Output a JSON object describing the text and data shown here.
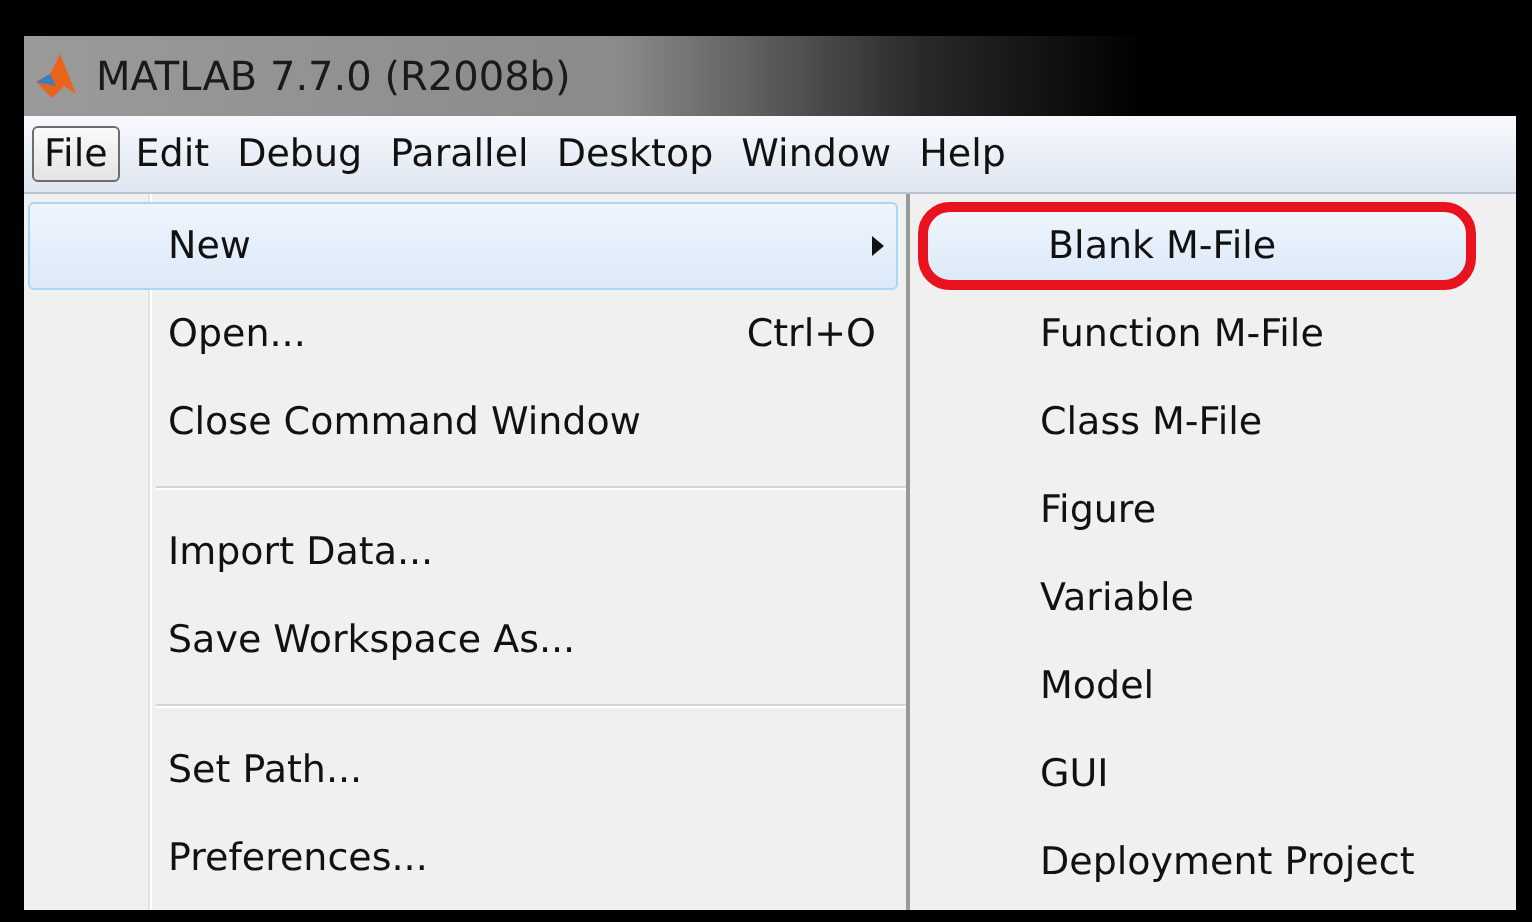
{
  "window": {
    "title": "MATLAB  7.7.0 (R2008b)"
  },
  "menu_bar": [
    {
      "label": "File",
      "selected": true
    },
    {
      "label": "Edit",
      "selected": false
    },
    {
      "label": "Debug",
      "selected": false
    },
    {
      "label": "Parallel",
      "selected": false
    },
    {
      "label": "Desktop",
      "selected": false
    },
    {
      "label": "Window",
      "selected": false
    },
    {
      "label": "Help",
      "selected": false
    }
  ],
  "file_menu": [
    {
      "kind": "item",
      "label": "New",
      "has_submenu": true,
      "highlighted": true
    },
    {
      "kind": "item",
      "label": "Open...",
      "shortcut": "Ctrl+O",
      "has_submenu": false,
      "highlighted": false
    },
    {
      "kind": "item",
      "label": "Close Command Window",
      "has_submenu": false,
      "highlighted": false
    },
    {
      "kind": "separator"
    },
    {
      "kind": "item",
      "label": "Import Data...",
      "has_submenu": false,
      "highlighted": false
    },
    {
      "kind": "item",
      "label": "Save Workspace As...",
      "has_submenu": false,
      "highlighted": false
    },
    {
      "kind": "separator"
    },
    {
      "kind": "item",
      "label": "Set Path...",
      "has_submenu": false,
      "highlighted": false
    },
    {
      "kind": "item",
      "label": "Preferences...",
      "has_submenu": false,
      "highlighted": false
    }
  ],
  "new_submenu": [
    {
      "label": "Blank M-File",
      "highlighted": true,
      "circled": true
    },
    {
      "label": "Function M-File",
      "highlighted": false,
      "circled": false
    },
    {
      "label": "Class M-File",
      "highlighted": false,
      "circled": false
    },
    {
      "label": "Figure",
      "highlighted": false,
      "circled": false
    },
    {
      "label": "Variable",
      "highlighted": false,
      "circled": false
    },
    {
      "label": "Model",
      "highlighted": false,
      "circled": false
    },
    {
      "label": "GUI",
      "highlighted": false,
      "circled": false
    },
    {
      "label": "Deployment Project",
      "highlighted": false,
      "circled": false
    }
  ]
}
